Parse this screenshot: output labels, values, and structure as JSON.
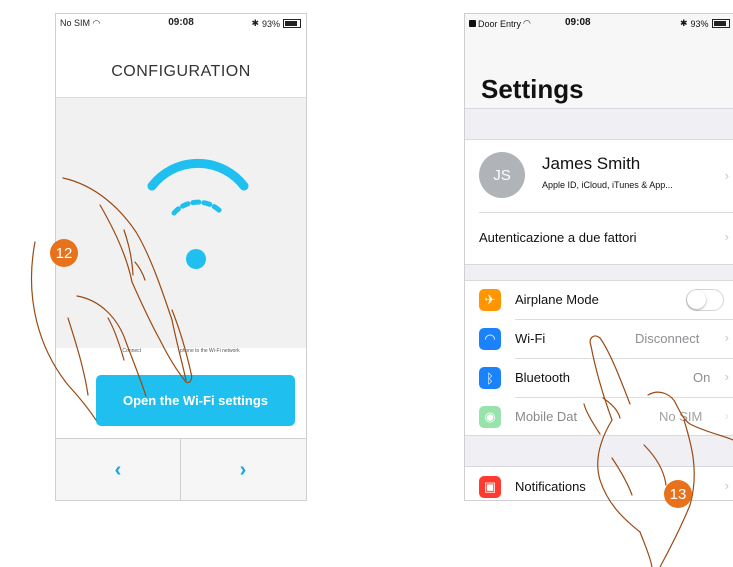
{
  "phone1": {
    "status": {
      "carrier": "No SIM",
      "time": "09:08",
      "battery": "93%"
    },
    "title": "CONFIGURATION",
    "caption_left": "Connect",
    "caption_right": "phone to the Wi-Fi network",
    "button_label": "Open the Wi-Fi settings",
    "nav": {
      "prev": "‹",
      "next": "›"
    },
    "badge": "12",
    "colors": {
      "accent": "#1fc0ef",
      "nav_arrow": "#14a7e0"
    }
  },
  "phone2": {
    "status": {
      "carrier": "Door Entry",
      "time": "09:08",
      "battery": "93%"
    },
    "title": "Settings",
    "profile": {
      "initials": "JS",
      "name": "James Smith",
      "subtitle": "Apple ID, iCloud, iTunes & App..."
    },
    "two_factor": "Autenticazione a due fattori",
    "rows": [
      {
        "icon": "airplane-icon",
        "label": "Airplane Mode",
        "value": "",
        "color": "#ff9500"
      },
      {
        "icon": "wifi-icon",
        "label": "Wi-Fi",
        "value": "Disconnect",
        "color": "#1a82fb"
      },
      {
        "icon": "bluetooth-icon",
        "label": "Bluetooth",
        "value": "On",
        "color": "#1a82fb"
      },
      {
        "icon": "antenna-icon",
        "label": "Mobile Dat",
        "value": "No SIM",
        "color": "#8ddd8f"
      }
    ],
    "notifications": {
      "icon": "notifications-icon",
      "label": "Notifications",
      "color": "#ff3b30"
    },
    "badge": "13"
  }
}
